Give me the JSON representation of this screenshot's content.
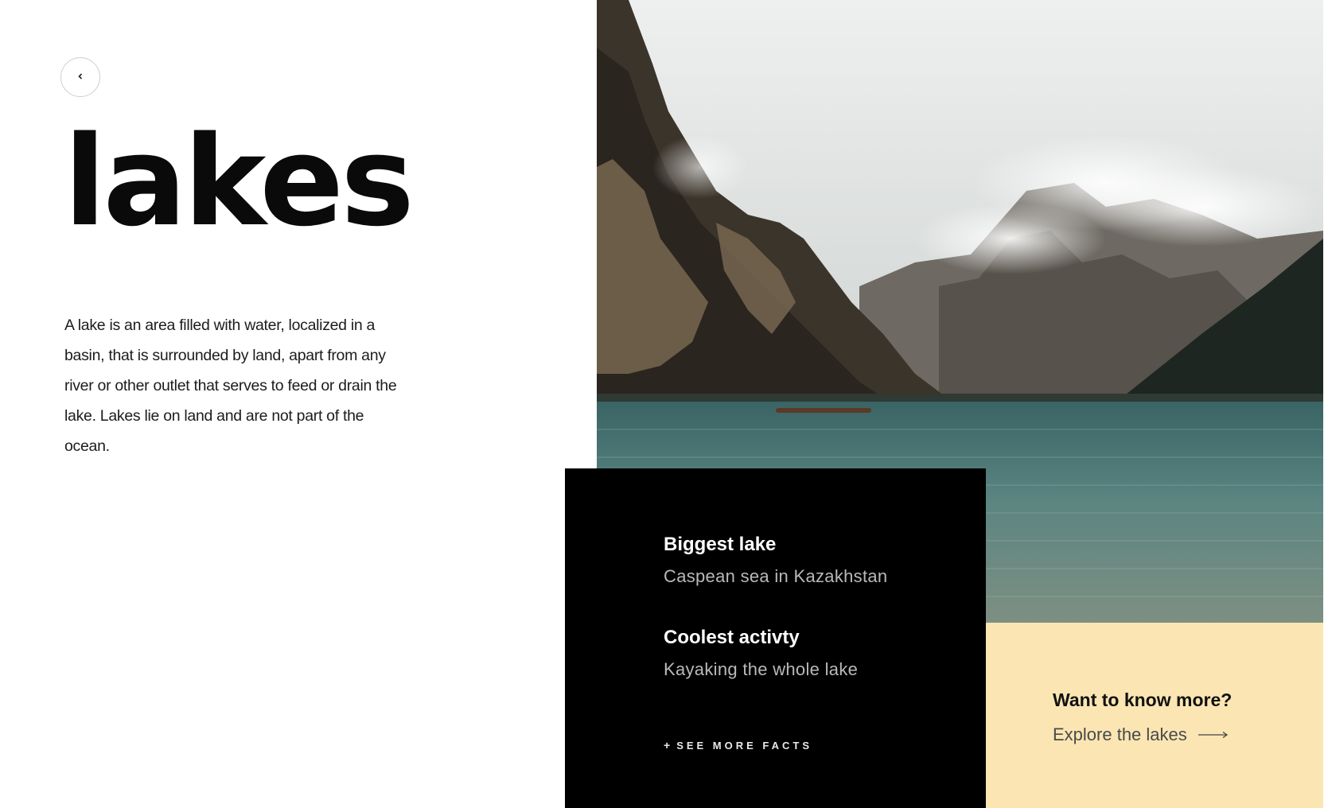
{
  "header": {
    "back_icon": "chevron-left-icon",
    "title": "lakes"
  },
  "intro": {
    "description": "A lake is an area filled with water, localized in a basin, that is surrounded by land, apart from any river or other outlet that serves to feed or drain the lake. Lakes lie on land and are not part of the ocean."
  },
  "facts": {
    "items": [
      {
        "title": "Biggest lake",
        "text": "Caspean sea in Kazakhstan"
      },
      {
        "title": "Coolest activty",
        "text": "Kayaking the whole lake"
      }
    ],
    "see_more_label": "SEE MORE FACTS",
    "see_more_icon": "plus-icon"
  },
  "cta": {
    "title": "Want to know more?",
    "link_label": "Explore the lakes",
    "link_icon": "arrow-right-icon"
  },
  "colors": {
    "facts_background": "#000000",
    "cta_background": "#fbe6b3",
    "lake_water": "#3e6a6a"
  }
}
